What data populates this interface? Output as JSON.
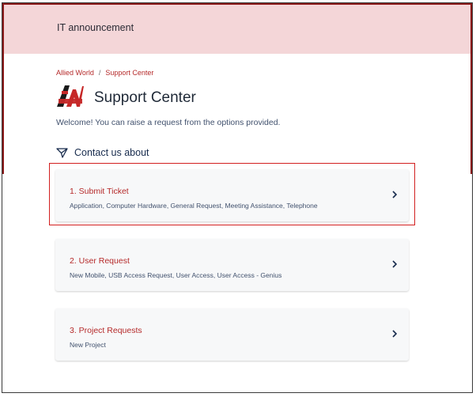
{
  "banner": {
    "text": "IT announcement"
  },
  "breadcrumb": [
    {
      "label": "Allied World"
    },
    {
      "label": "Support Center"
    }
  ],
  "breadcrumb_separator": "/",
  "header": {
    "title": "Support Center"
  },
  "welcome": "Welcome! You can raise a request from the options provided.",
  "contact_heading": "Contact us about",
  "options": [
    {
      "title": "1. Submit Ticket",
      "description": "Application, Computer Hardware, General Request, Meeting Assistance, Telephone"
    },
    {
      "title": "2. User Request",
      "description": "New Mobile, USB Access Request, User Access, User Access - Genius"
    },
    {
      "title": "3. Project Requests",
      "description": "New Project"
    }
  ],
  "colors": {
    "banner_bg": "#f4d6d8",
    "accent": "#b52a2a",
    "highlight": "#d21f1f",
    "card_bg": "#f7f8f9"
  }
}
